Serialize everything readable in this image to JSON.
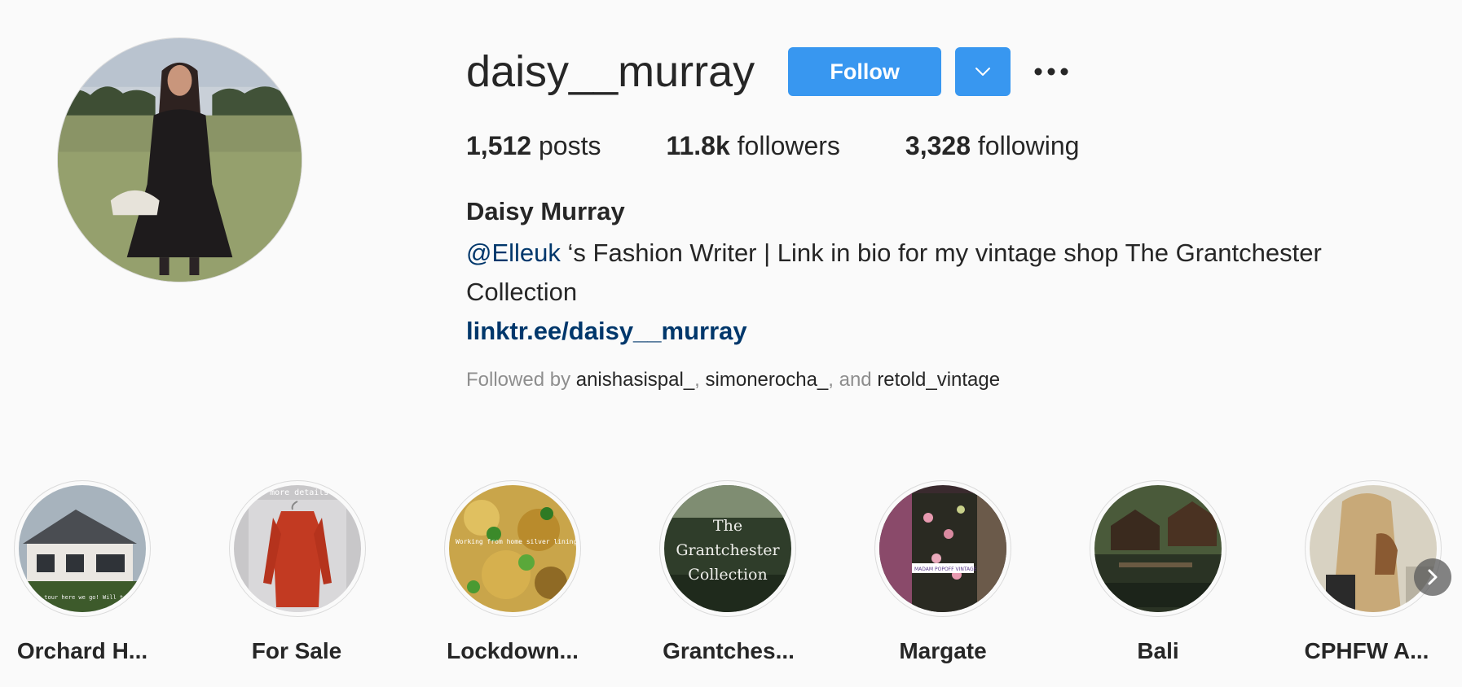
{
  "profile": {
    "username": "daisy__murray",
    "follow_label": "Follow",
    "stats": {
      "posts_count": "1,512",
      "posts_label": "posts",
      "followers_count": "11.8k",
      "followers_label": "followers",
      "following_count": "3,328",
      "following_label": "following"
    },
    "full_name": "Daisy Murray",
    "bio_mention": "@Elleuk",
    "bio_text_1": " ‘s Fashion Writer | Link in bio for my vintage shop The Grantchester",
    "bio_text_2": "Collection",
    "link": "linktr.ee/daisy__murray",
    "followed_by_prefix": "Followed by ",
    "followed_by": [
      "anishasispal_",
      "simonerocha_",
      "retold_vintage"
    ],
    "followed_sep": ", ",
    "followed_and": ", and "
  },
  "highlights": [
    {
      "label": "Orchard H..."
    },
    {
      "label": "For Sale"
    },
    {
      "label": "Lockdown..."
    },
    {
      "label": "Grantches..."
    },
    {
      "label": "Margate"
    },
    {
      "label": "Bali"
    },
    {
      "label": "CPHFW A..."
    }
  ],
  "highlight_image_text": {
    "grantchester": [
      "The",
      "Grantchester",
      "Collection"
    ],
    "lockdown": "Working from home silver linings",
    "orchard": "house tour here we go! Will try be fairly swift, but prepare for major story",
    "forsale": "for more details",
    "margate": "MADAM POPOFF VINTAGE"
  },
  "colors": {
    "accent": "#3897f0",
    "link": "#00376b",
    "muted": "#8e8e8e",
    "text": "#262626",
    "background": "#fafafa"
  },
  "icons": [
    "chevron-down-icon",
    "more-dots-icon",
    "chevron-right-icon"
  ]
}
